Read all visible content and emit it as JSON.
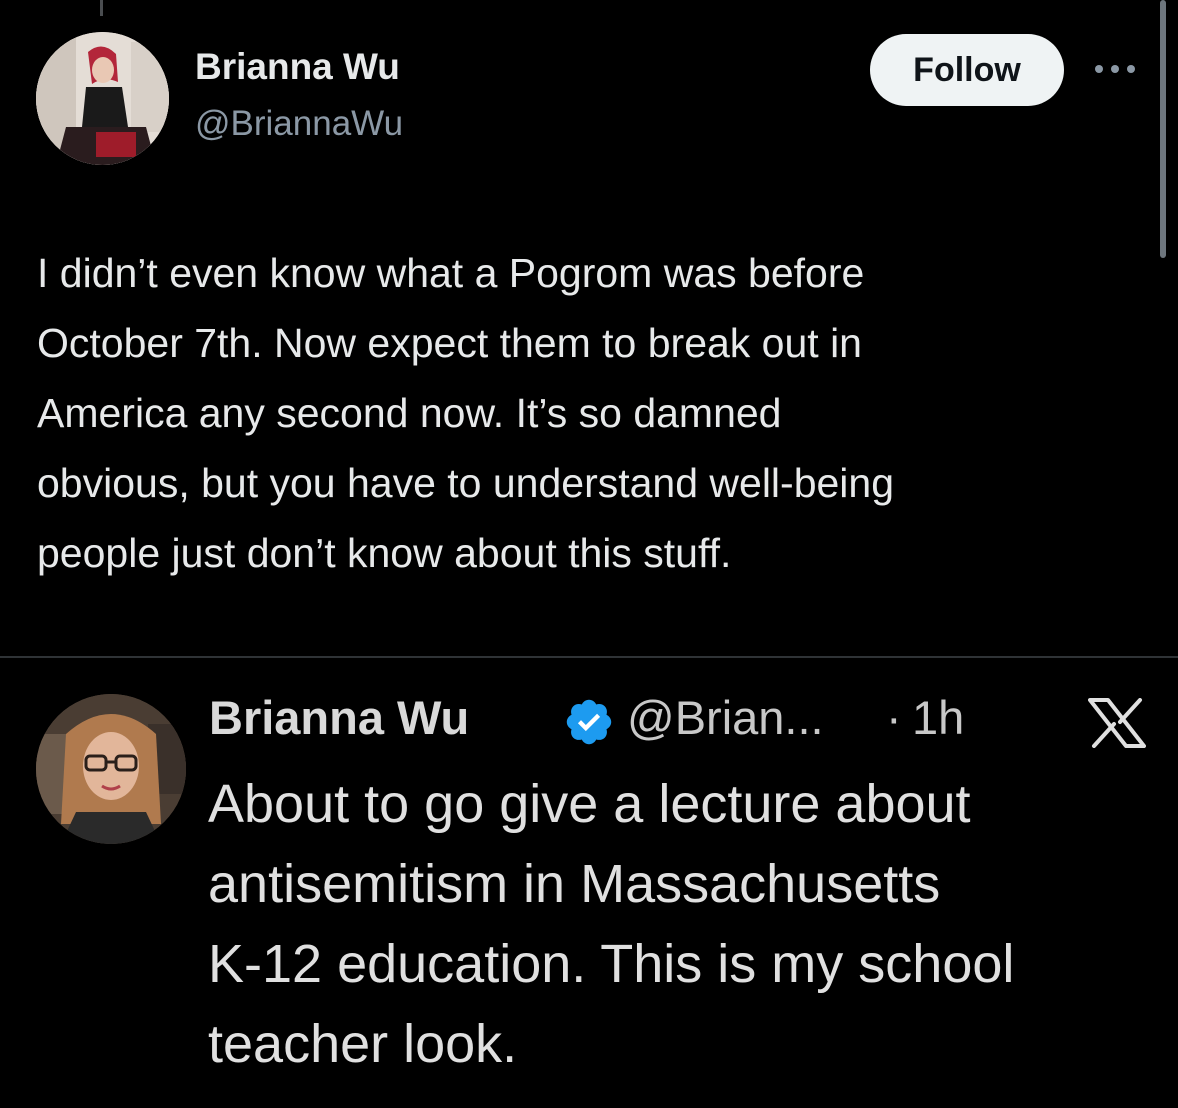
{
  "tweet": {
    "display_name": "Brianna Wu",
    "handle": "@BriannaWu",
    "follow_label": "Follow",
    "more_icon": "more-dots-icon",
    "text": "I didn’t even know what a Pogrom was before\nOctober 7th. Now expect them to break out in\nAmerica any second now. It’s so damned\nobvious, but you have to understand well-being\npeople just don’t know about this stuff."
  },
  "quoted_tweet": {
    "display_name": "Brianna Wu",
    "verified_icon": "verified-badge-icon",
    "handle": "@Brian...",
    "separator": "·",
    "time": "1h",
    "platform_icon": "x-logo-icon",
    "text": "About to go give a lecture about\nantisemitism in Massachusetts\nK-12 education. This is my school\nteacher look."
  },
  "colors": {
    "background": "#000000",
    "text_primary": "#e7e9ea",
    "text_secondary": "#8b98a5",
    "follow_button_bg": "#eff3f4",
    "verified_blue": "#1d9bf0",
    "divider": "#2f3336"
  }
}
